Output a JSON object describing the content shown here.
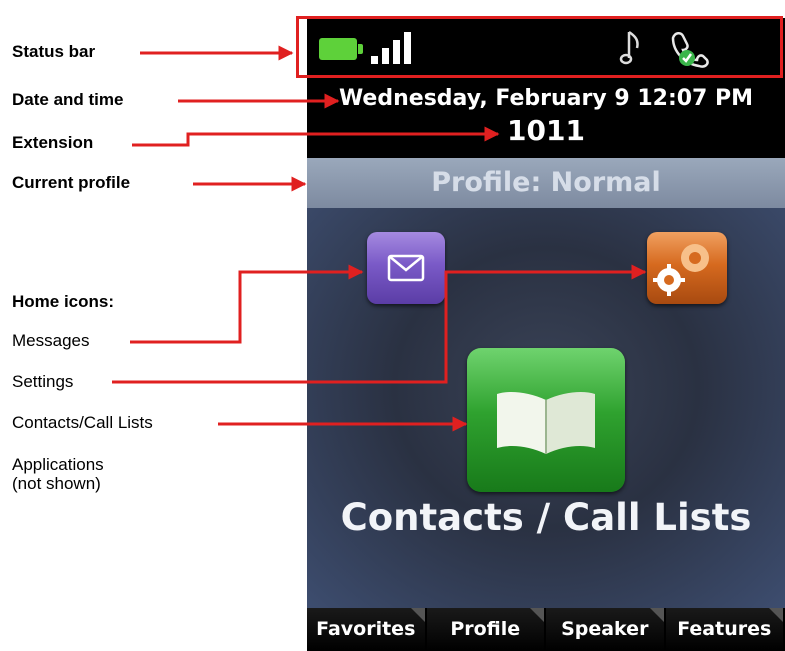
{
  "callouts": {
    "status_bar": "Status bar",
    "date_time": "Date and time",
    "extension": "Extension",
    "current_profile": "Current profile",
    "home_icons": "Home icons:",
    "messages": "Messages",
    "settings": "Settings",
    "contacts": "Contacts/Call Lists",
    "applications_1": "Applications",
    "applications_2": "(not shown)"
  },
  "screen": {
    "datetime": "Wednesday, February 9 12:07 PM",
    "extension": "1011",
    "profile": "Profile: Normal",
    "contacts_label": "Contacts / Call Lists",
    "softkeys": [
      "Favorites",
      "Profile",
      "Speaker",
      "Features"
    ]
  },
  "icons": {
    "battery": "battery-icon",
    "signal": "signal-strength-icon",
    "ringer": "music-note-icon",
    "registration": "phone-registered-icon",
    "messages": "envelope-icon",
    "settings": "gear-icon",
    "contacts": "open-book-icon"
  },
  "colors": {
    "callout_red": "#e02020",
    "battery_green": "#5ed13a",
    "messages_purple": "#7a5ac7",
    "settings_orange": "#d66a1f",
    "contacts_green": "#2fa22f"
  }
}
